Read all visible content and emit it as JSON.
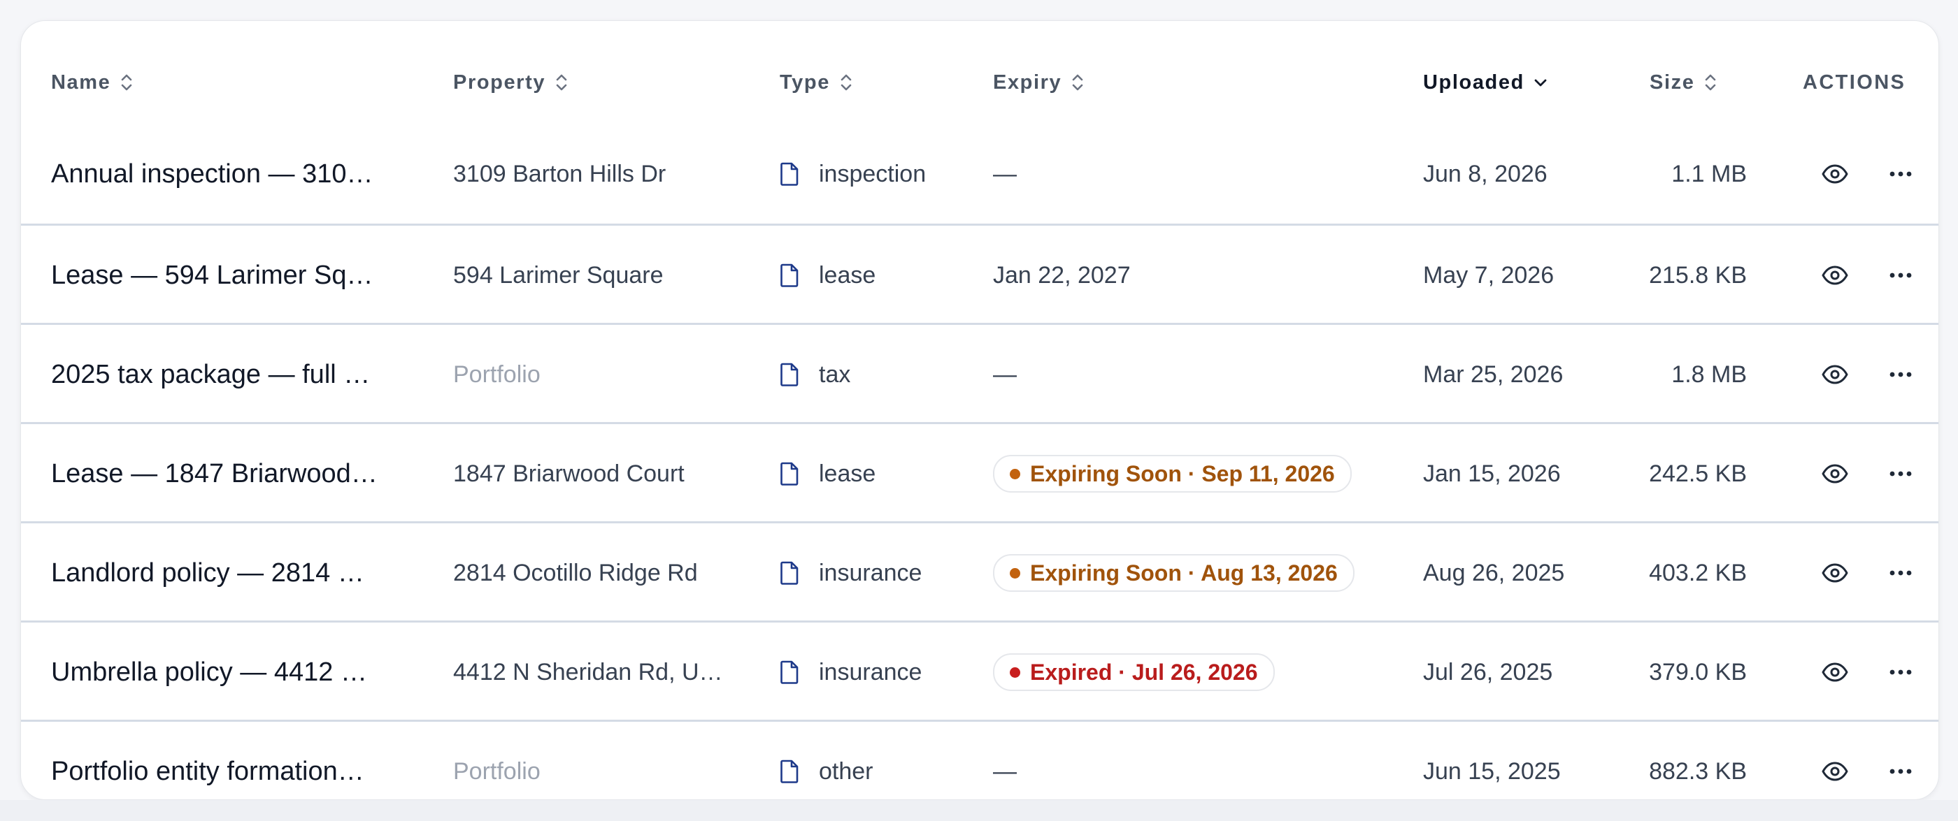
{
  "table": {
    "columns": {
      "name": "Name",
      "property": "Property",
      "type": "Type",
      "expiry": "Expiry",
      "uploaded": "Uploaded",
      "size": "Size",
      "actions": "ACTIONS"
    },
    "sort": {
      "column": "uploaded",
      "direction": "descending"
    },
    "rows": [
      {
        "name": "Annual inspection — 310…",
        "property": "3109 Barton Hills Dr",
        "property_muted": false,
        "type": "inspection",
        "expiry": "—",
        "expiry_status": "none",
        "uploaded": "Jun 8, 2026",
        "size": "1.1 MB"
      },
      {
        "name": "Lease — 594 Larimer Sq…",
        "property": "594 Larimer Square",
        "property_muted": false,
        "type": "lease",
        "expiry": "Jan 22, 2027",
        "expiry_status": "none",
        "uploaded": "May 7, 2026",
        "size": "215.8 KB"
      },
      {
        "name": "2025 tax package — full …",
        "property": "Portfolio",
        "property_muted": true,
        "type": "tax",
        "expiry": "—",
        "expiry_status": "none",
        "uploaded": "Mar 25, 2026",
        "size": "1.8 MB"
      },
      {
        "name": "Lease — 1847 Briarwood…",
        "property": "1847 Briarwood Court",
        "property_muted": false,
        "type": "lease",
        "expiry": "Expiring Soon · Sep 11, 2026",
        "expiry_status": "expiring",
        "uploaded": "Jan 15, 2026",
        "size": "242.5 KB"
      },
      {
        "name": "Landlord policy — 2814 …",
        "property": "2814 Ocotillo Ridge Rd",
        "property_muted": false,
        "type": "insurance",
        "expiry": "Expiring Soon · Aug 13, 2026",
        "expiry_status": "expiring",
        "uploaded": "Aug 26, 2025",
        "size": "403.2 KB"
      },
      {
        "name": "Umbrella policy — 4412 …",
        "property": "4412 N Sheridan Rd, U…",
        "property_muted": false,
        "type": "insurance",
        "expiry": "Expired · Jul 26, 2026",
        "expiry_status": "expired",
        "uploaded": "Jul 26, 2025",
        "size": "379.0 KB"
      },
      {
        "name": "Portfolio entity formation…",
        "property": "Portfolio",
        "property_muted": true,
        "type": "other",
        "expiry": "—",
        "expiry_status": "none",
        "uploaded": "Jun 15, 2025",
        "size": "882.3 KB"
      }
    ],
    "row_actions": {
      "view_icon": "eye-icon",
      "more_icon": "more-horizontal-icon"
    },
    "type_icon": "file-icon"
  },
  "colors": {
    "expiring": "#a0530b",
    "expiring_dot": "#c2620f",
    "expired": "#b91c1c",
    "expired_dot": "#c81e1e",
    "file_icon": "#1e3a8a",
    "row_divider": "#d4dbe5"
  }
}
